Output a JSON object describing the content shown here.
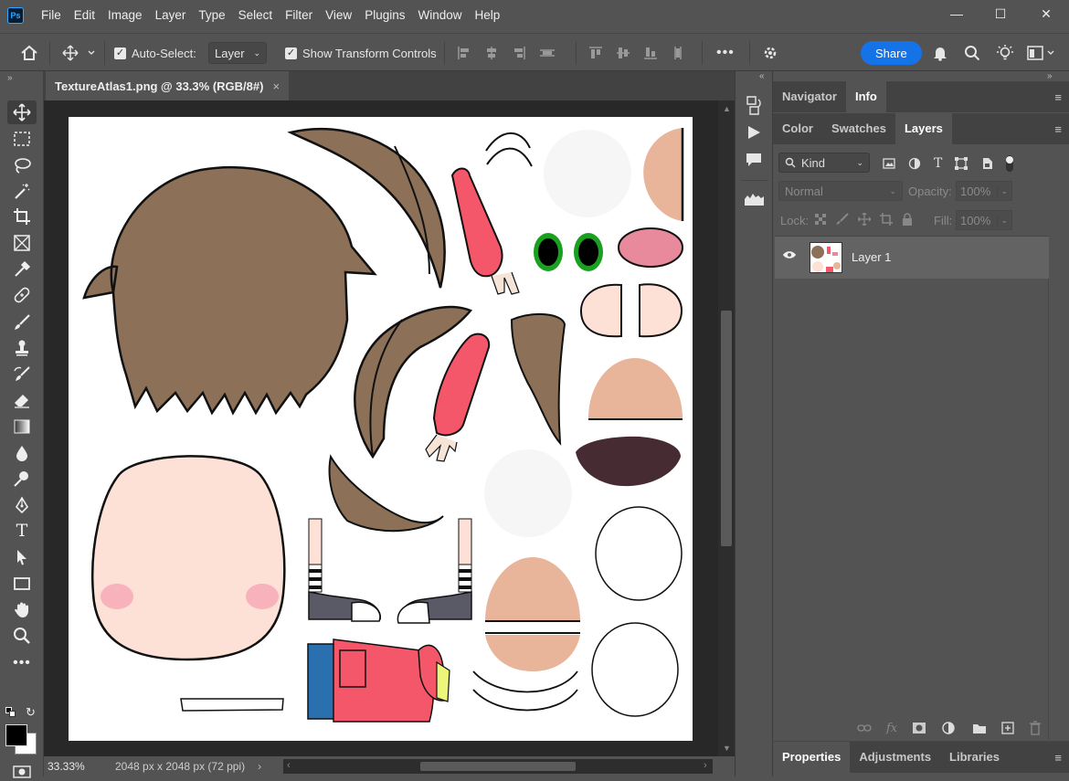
{
  "app": {
    "logo": "Ps"
  },
  "menu": [
    "File",
    "Edit",
    "Image",
    "Layer",
    "Type",
    "Select",
    "Filter",
    "View",
    "Plugins",
    "Window",
    "Help"
  ],
  "window_controls": {
    "minimize": "—",
    "maximize": "☐",
    "close": "✕"
  },
  "options": {
    "auto_select_label": "Auto-Select:",
    "auto_select_value": "Layer",
    "show_transform_label": "Show Transform Controls",
    "more": "•••",
    "share": "Share"
  },
  "document": {
    "tab_title": "TextureAtlas1.png @ 33.3% (RGB/8#)",
    "close": "×",
    "zoom": "33.33%",
    "dimensions": "2048 px x 2048 px (72 ppi)"
  },
  "panels": {
    "top_tabs": [
      "Navigator",
      "Info"
    ],
    "top_active": "Info",
    "mid_tabs": [
      "Color",
      "Swatches",
      "Layers"
    ],
    "mid_active": "Layers",
    "kind_label": "Kind",
    "blend_mode": "Normal",
    "opacity_label": "Opacity:",
    "opacity_value": "100%",
    "lock_label": "Lock:",
    "fill_label": "Fill:",
    "fill_value": "100%",
    "layers": [
      {
        "name": "Layer 1",
        "visible": true
      }
    ],
    "bottom_tabs": [
      "Properties",
      "Adjustments",
      "Libraries"
    ],
    "bottom_active": "Properties"
  },
  "colors": {
    "accent": "#1473e6",
    "foreground": "#000000",
    "background": "#ffffff"
  }
}
